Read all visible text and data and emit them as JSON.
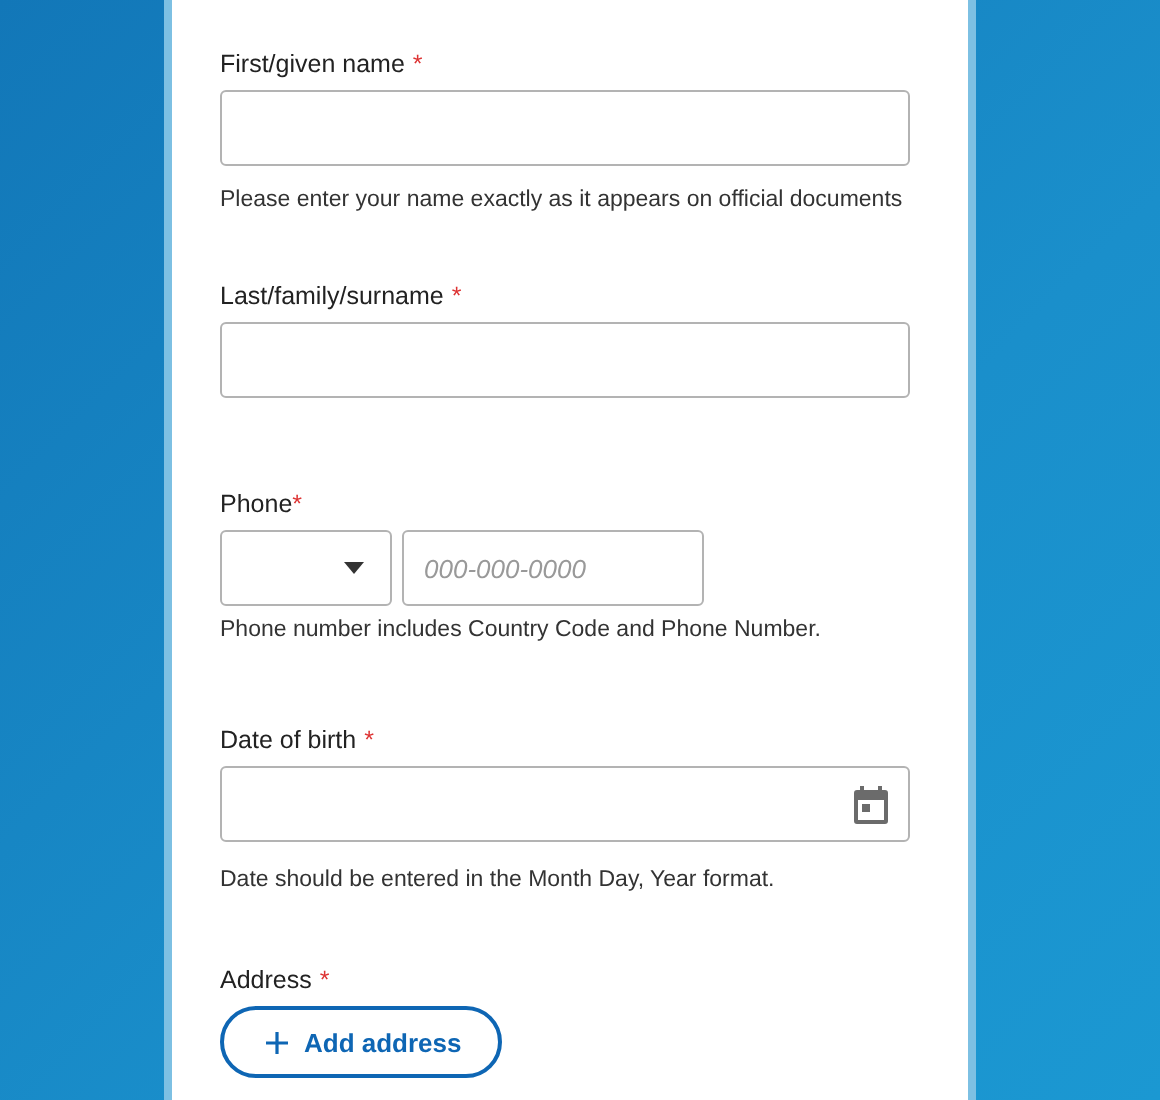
{
  "fields": [
    {
      "kind": "text",
      "label": "First/given name",
      "required_mark": "*",
      "hint": "Please enter your name exactly as it appears on official documents"
    },
    {
      "kind": "text",
      "label": "Last/family/surname",
      "required_mark": "*"
    },
    {
      "kind": "phone",
      "label": "Phone",
      "required_mark": "*",
      "placeholder": "000-000-0000",
      "hint": "Phone number includes Country Code and Phone Number."
    },
    {
      "kind": "date",
      "label": "Date of birth",
      "required_mark": "*",
      "hint": "Date should be entered in the Month Day, Year format."
    },
    {
      "kind": "address",
      "label": "Address",
      "required_mark": "*",
      "button": "Add address"
    }
  ]
}
